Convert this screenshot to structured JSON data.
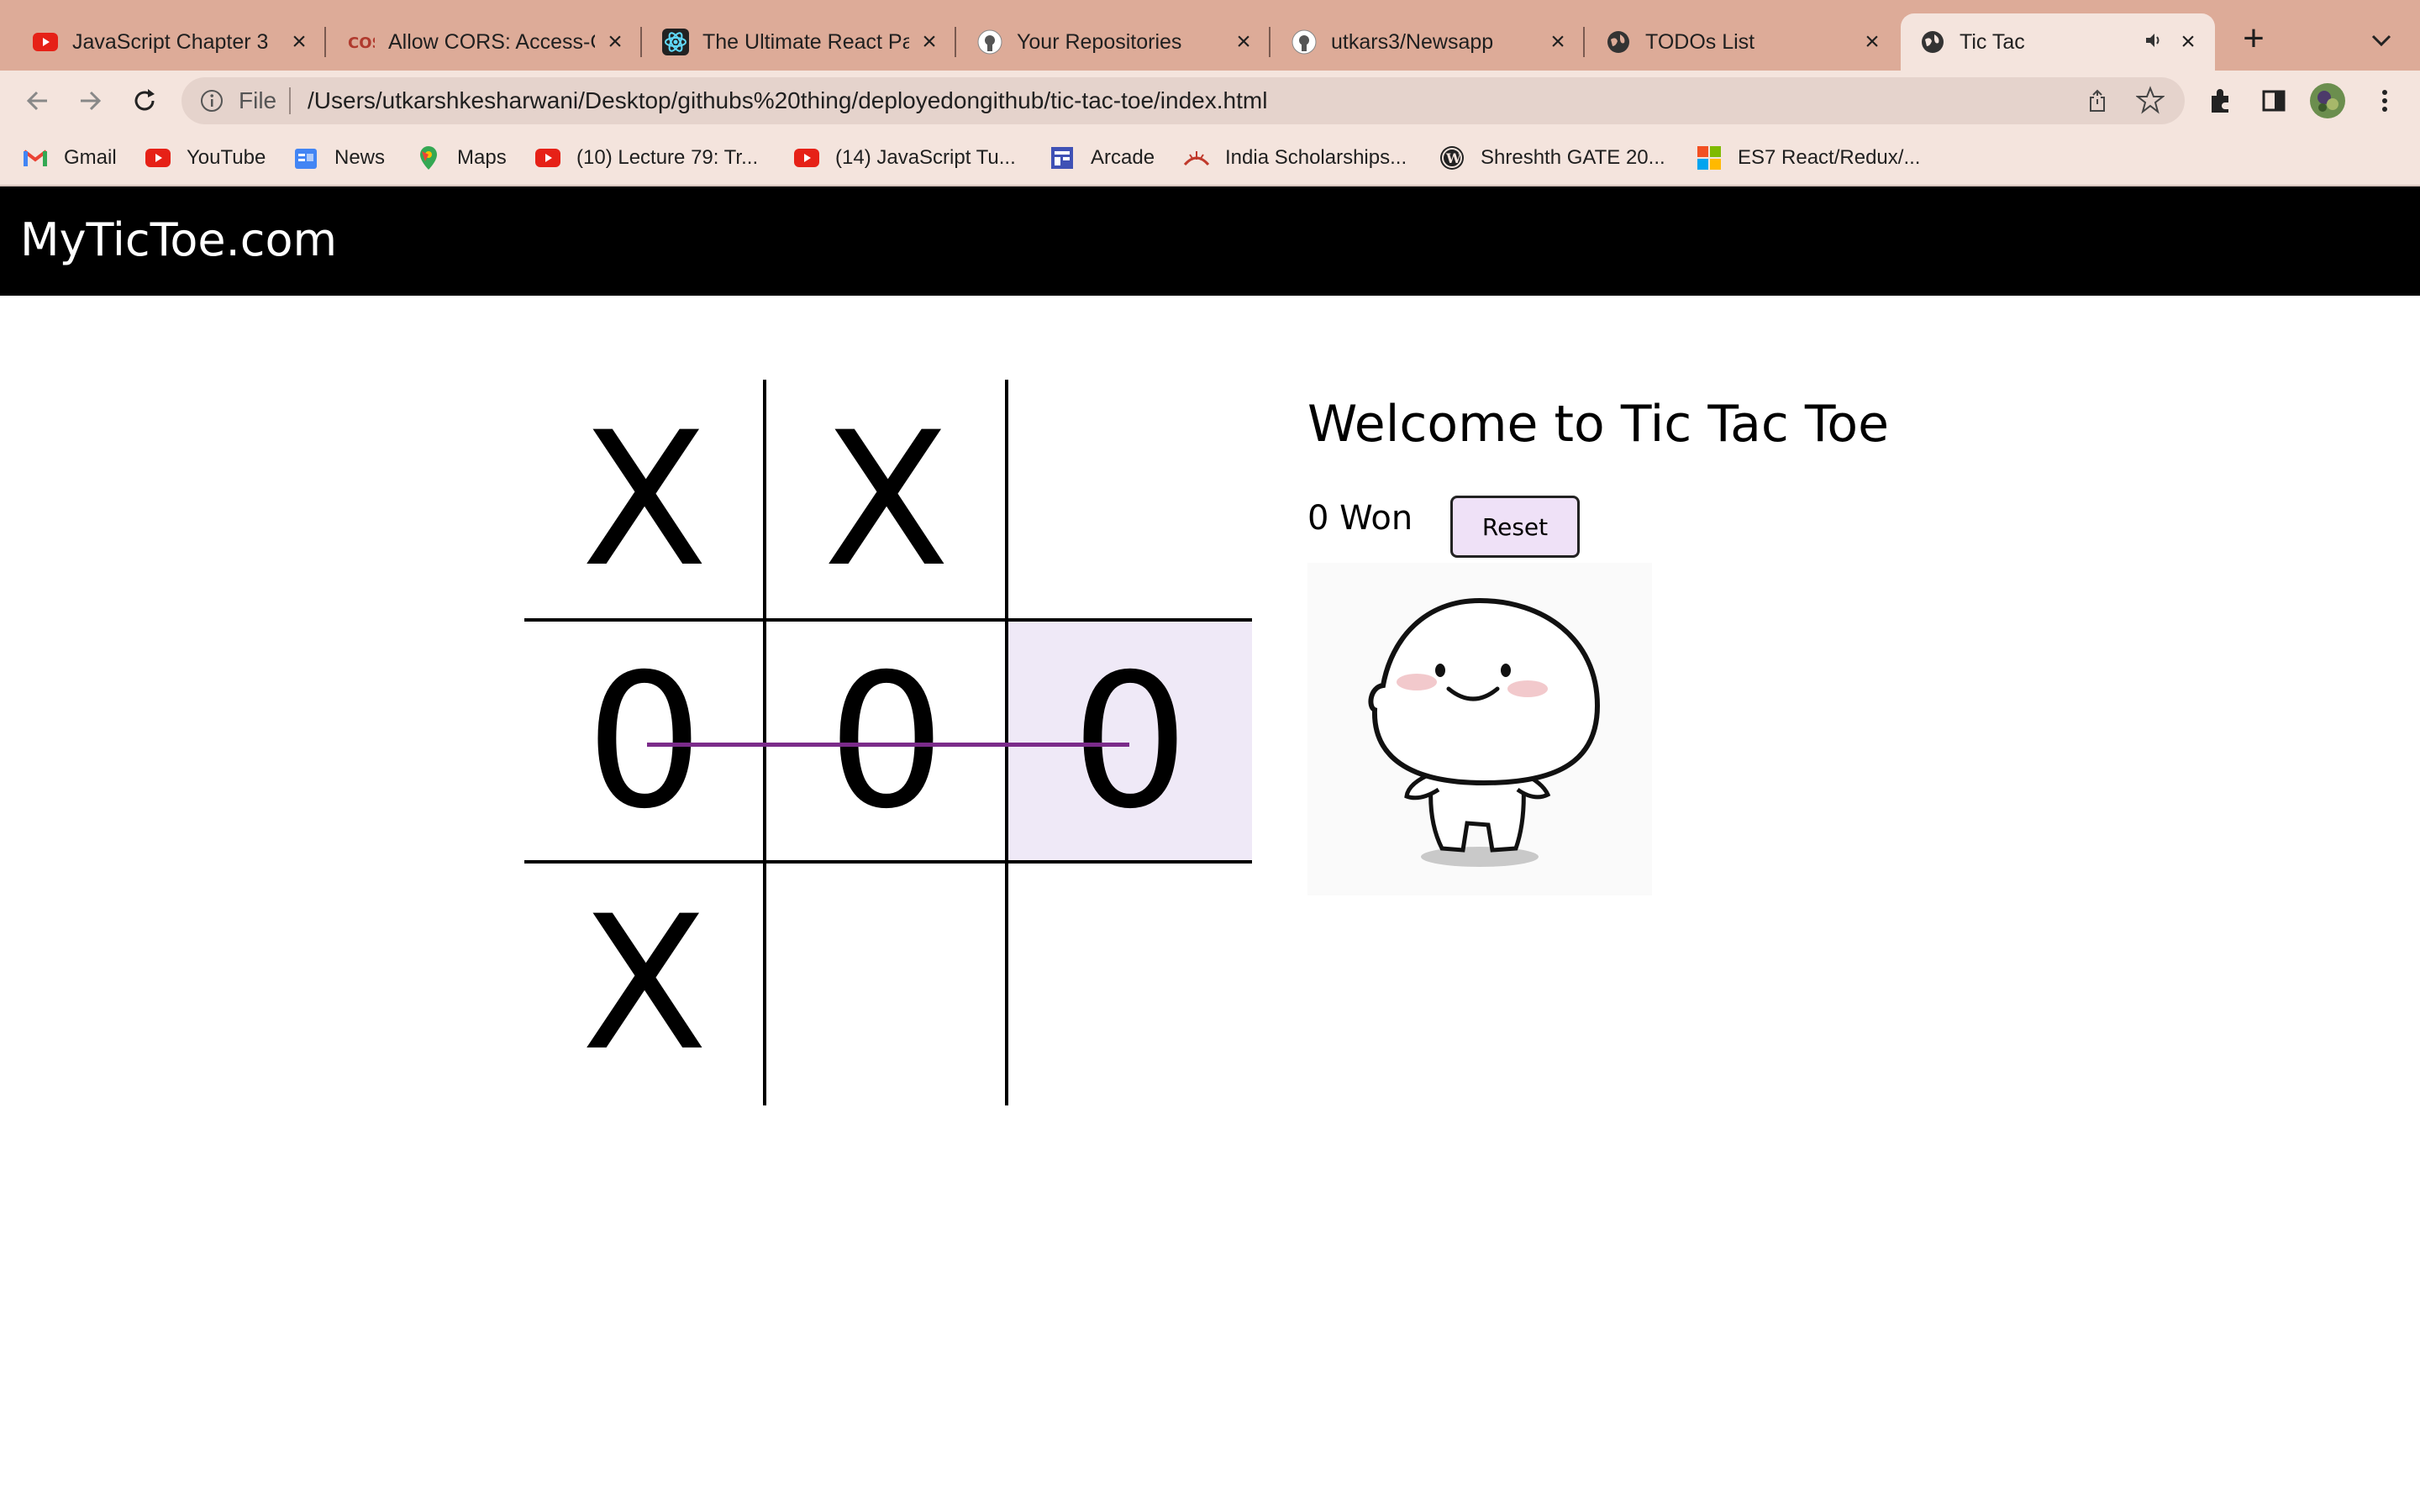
{
  "browser": {
    "tabs": [
      {
        "title": "JavaScript Chapter 3",
        "icon": "youtube-icon"
      },
      {
        "title": "Allow CORS: Access-C",
        "icon": "cors-icon"
      },
      {
        "title": "The Ultimate React Pa",
        "icon": "react-icon"
      },
      {
        "title": "Your Repositories",
        "icon": "github-icon"
      },
      {
        "title": "utkars3/Newsapp",
        "icon": "github-icon"
      },
      {
        "title": "TODOs List",
        "icon": "globe-icon"
      },
      {
        "title": "Tic Tac",
        "icon": "globe-icon",
        "active": true,
        "audio": true
      }
    ],
    "omnibox": {
      "scheme_label": "File",
      "url": "/Users/utkarshkesharwani/Desktop/githubs%20thing/deployedongithub/tic-tac-toe/index.html"
    },
    "bookmarks": [
      {
        "label": "Gmail",
        "icon": "gmail-icon"
      },
      {
        "label": "YouTube",
        "icon": "youtube-icon"
      },
      {
        "label": "News",
        "icon": "news-icon"
      },
      {
        "label": "Maps",
        "icon": "maps-icon"
      },
      {
        "label": "(10) Lecture 79: Tr...",
        "icon": "youtube-icon"
      },
      {
        "label": "(14) JavaScript Tu...",
        "icon": "youtube-icon"
      },
      {
        "label": "Arcade",
        "icon": "arcade-icon"
      },
      {
        "label": "India Scholarships...",
        "icon": "scholarship-icon"
      },
      {
        "label": "Shreshth GATE 20...",
        "icon": "wordpress-icon"
      },
      {
        "label": "ES7 React/Redux/...",
        "icon": "microsoft-icon"
      }
    ]
  },
  "page": {
    "site_title": "MyTicToe.com",
    "board": [
      "X",
      "X",
      "",
      "0",
      "0",
      "0",
      "X",
      "",
      ""
    ],
    "welcome": "Welcome to Tic Tac Toe",
    "status": "0 Won",
    "reset_label": "Reset",
    "colors": {
      "header_bg": "#000000",
      "win_cell_bg": "#efe9f7",
      "strike_line": "#7b2b8a",
      "reset_bg": "#efe1f7"
    }
  }
}
